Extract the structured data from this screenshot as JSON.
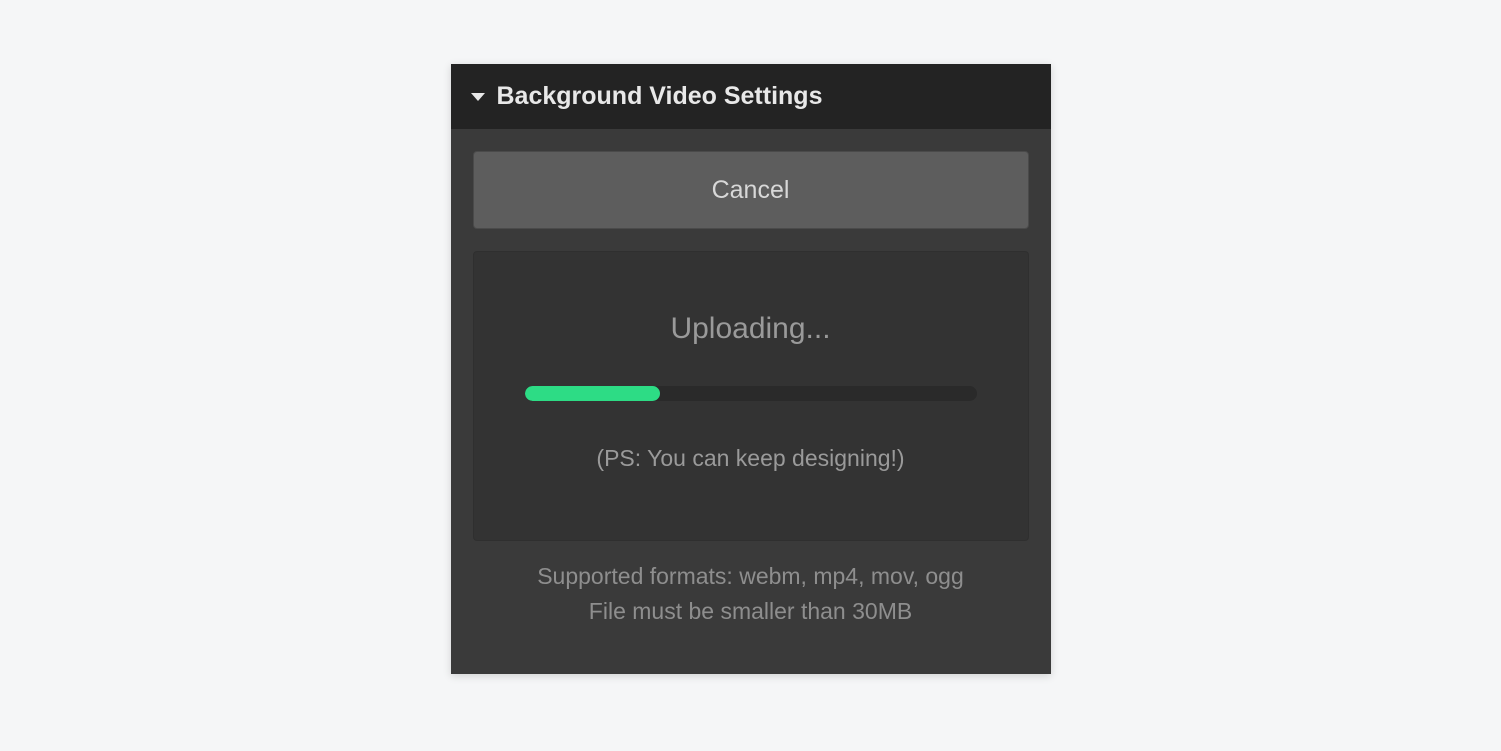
{
  "panel": {
    "title": "Background Video Settings",
    "cancel_label": "Cancel",
    "upload": {
      "status_text": "Uploading...",
      "hint_text": "(PS: You can keep designing!)",
      "progress_percent": 30
    },
    "footer": {
      "line1": "Supported formats: webm, mp4, mov, ogg",
      "line2": "File must be smaller than 30MB"
    }
  },
  "colors": {
    "accent_green": "#2ddc85"
  }
}
